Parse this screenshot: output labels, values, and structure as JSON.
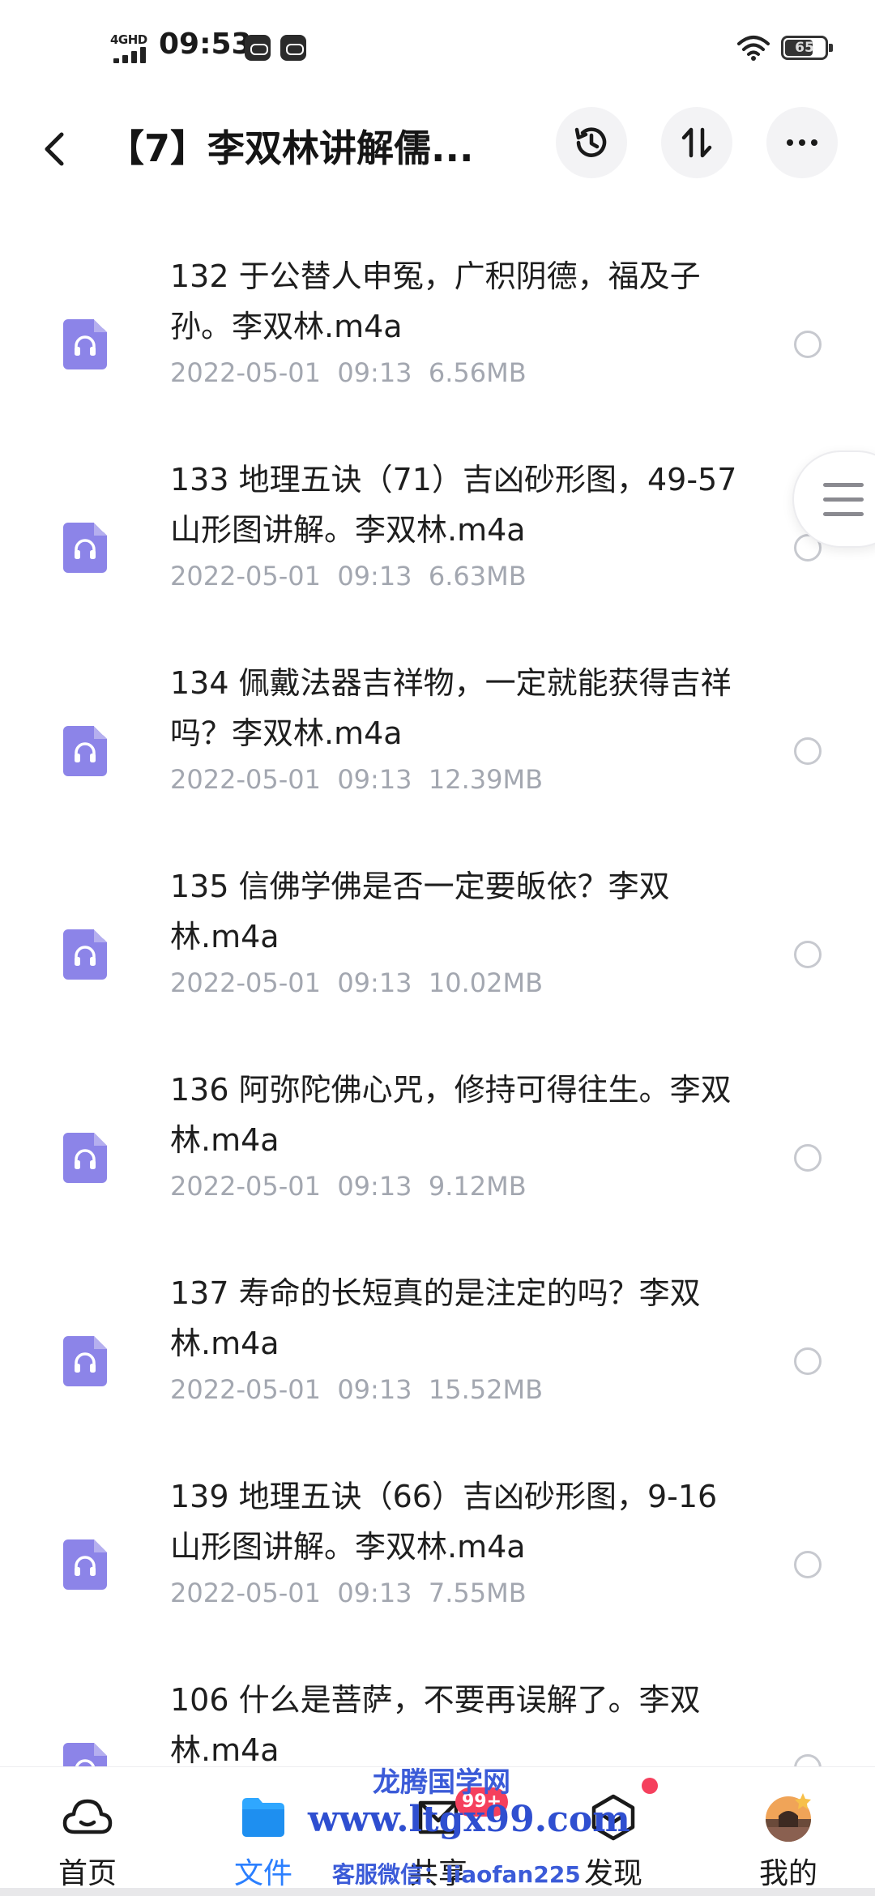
{
  "status_bar": {
    "network": "4GHD",
    "time": "09:53",
    "battery": "65"
  },
  "header": {
    "title": "【7】李双林讲解儒..."
  },
  "files": [
    {
      "name": "132 于公替人申冤，广积阴德，福及子孙。李双林.m4a",
      "date": "2022-05-01",
      "time": "09:13",
      "size": "6.56MB"
    },
    {
      "name": "133 地理五诀（71）吉凶砂形图，49-57山形图讲解。李双林.m4a",
      "date": "2022-05-01",
      "time": "09:13",
      "size": "6.63MB"
    },
    {
      "name": "134 佩戴法器吉祥物，一定就能获得吉祥吗？李双林.m4a",
      "date": "2022-05-01",
      "time": "09:13",
      "size": "12.39MB"
    },
    {
      "name": "135 信佛学佛是否一定要皈依？李双林.m4a",
      "date": "2022-05-01",
      "time": "09:13",
      "size": "10.02MB"
    },
    {
      "name": "136 阿弥陀佛心咒，修持可得往生。李双林.m4a",
      "date": "2022-05-01",
      "time": "09:13",
      "size": "9.12MB"
    },
    {
      "name": "137 寿命的长短真的是注定的吗？李双林.m4a",
      "date": "2022-05-01",
      "time": "09:13",
      "size": "15.52MB"
    },
    {
      "name": "139 地理五诀（66）吉凶砂形图，9-16山形图讲解。李双林.m4a",
      "date": "2022-05-01",
      "time": "09:13",
      "size": "7.55MB"
    },
    {
      "name": "106 什么是菩萨，不要再误解了。李双林.m4a",
      "date": "",
      "time": "",
      "size": ""
    }
  ],
  "tabs": [
    {
      "label": "首页",
      "icon": "cloud-icon"
    },
    {
      "label": "文件",
      "icon": "folder-icon",
      "active": true
    },
    {
      "label": "共享",
      "icon": "share-icon"
    },
    {
      "label": "发现",
      "icon": "discover-icon"
    },
    {
      "label": "我的",
      "icon": "avatar-icon"
    }
  ],
  "share_badge": "99+",
  "watermark": {
    "line1": "龙腾国学网",
    "line2": "www.ltgx99.com",
    "line3": "客服微信：liaofan225"
  }
}
